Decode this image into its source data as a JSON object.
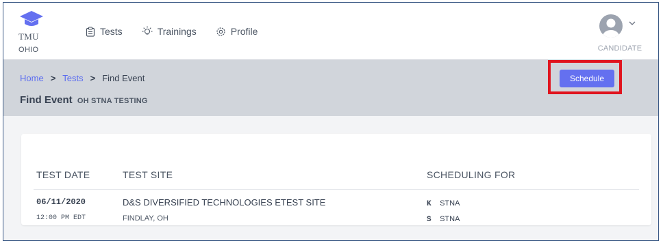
{
  "brand": {
    "name": "TMU",
    "state": "OHIO",
    "accent": "#6470f0"
  },
  "nav": [
    {
      "label": "Tests",
      "icon": "clipboard-icon"
    },
    {
      "label": "Trainings",
      "icon": "lightbulb-icon"
    },
    {
      "label": "Profile",
      "icon": "gear-icon"
    }
  ],
  "user": {
    "role": "CANDIDATE"
  },
  "breadcrumb": {
    "home": "Home",
    "tests": "Tests",
    "current": "Find Event",
    "separator": ">"
  },
  "page": {
    "title": "Find Event",
    "subtitle": "OH STNA TESTING"
  },
  "table": {
    "headers": [
      "TEST DATE",
      "TEST SITE",
      "SCHEDULING FOR"
    ],
    "rows": [
      {
        "date": "06/11/2020",
        "time": "12:00 PM EDT",
        "site": "D&S DIVERSIFIED TECHNOLOGIES ETEST SITE",
        "location": "FINDLAY, OH",
        "scheduling": [
          {
            "code": "K",
            "label": "STNA"
          },
          {
            "code": "S",
            "label": "STNA"
          }
        ],
        "action": "Schedule"
      }
    ]
  },
  "highlight_color": "#e0141e"
}
